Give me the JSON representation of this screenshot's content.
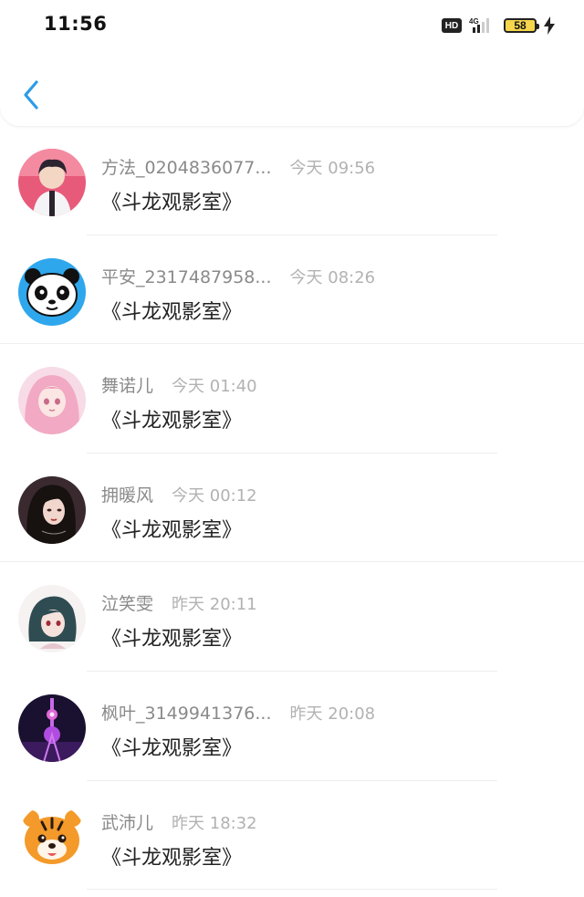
{
  "status_bar": {
    "time": "11:56",
    "hd_label": "HD",
    "network": "4G",
    "battery": "58"
  },
  "nav": {
    "back_icon": "chevron-left-icon",
    "accent": "#2a9ce8"
  },
  "items": [
    {
      "name": "方法_0204836077...",
      "time": "今天 09:56",
      "message": "《斗龙观影室》",
      "avatar": "anime-boy"
    },
    {
      "name": "平安_2317487958...",
      "time": "今天 08:26",
      "message": "《斗龙观影室》",
      "avatar": "panda"
    },
    {
      "name": "舞诺儿",
      "time": "今天 01:40",
      "message": "《斗龙观影室》",
      "avatar": "pink-anime-girl"
    },
    {
      "name": "拥暖风",
      "time": "今天 00:12",
      "message": "《斗龙观影室》",
      "avatar": "dark-hair-girl"
    },
    {
      "name": "泣笑雯",
      "time": "昨天 20:11",
      "message": "《斗龙观影室》",
      "avatar": "anime-girl-teal"
    },
    {
      "name": "枫叶_3149941376...",
      "time": "昨天 20:08",
      "message": "《斗龙观影室》",
      "avatar": "night-tower"
    },
    {
      "name": "武沛儿",
      "time": "昨天 18:32",
      "message": "《斗龙观影室》",
      "avatar": "tiger-cub"
    }
  ]
}
